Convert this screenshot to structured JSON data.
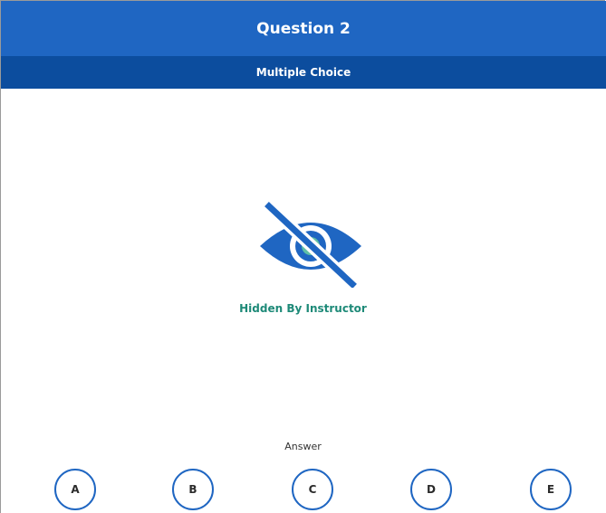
{
  "header": {
    "title": "Question 2",
    "subtitle": "Multiple Choice"
  },
  "content": {
    "hidden_icon": "eye-off-icon",
    "hidden_text": "Hidden By Instructor"
  },
  "answer": {
    "label": "Answer",
    "choices": [
      "A",
      "B",
      "C",
      "D",
      "E"
    ]
  },
  "colors": {
    "header": "#1f66c2",
    "subheader": "#0c4d9e",
    "icon_blue": "#1f66c2",
    "icon_teal": "#5fbfa6",
    "hidden_text": "#1e8a78"
  }
}
